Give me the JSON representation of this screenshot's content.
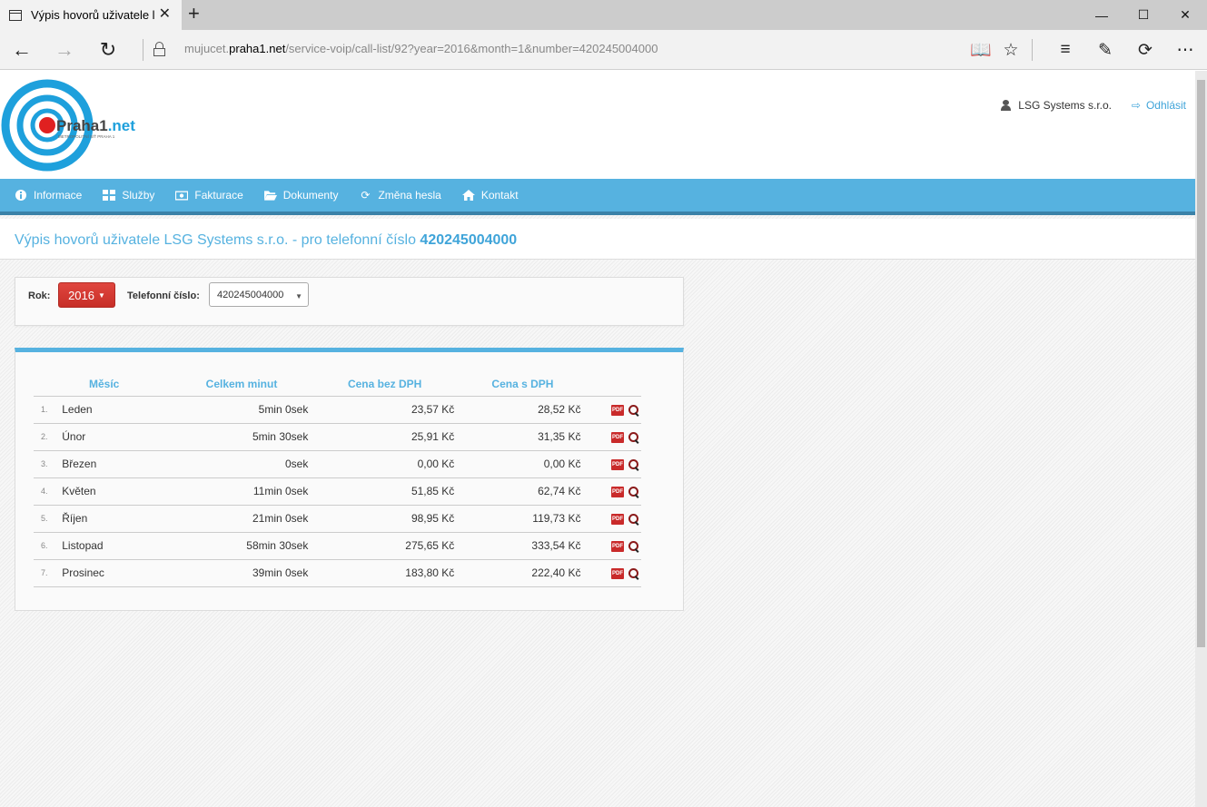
{
  "browser": {
    "tab_title": "Výpis hovorů uživatele l",
    "url_prefix": "mujucet.",
    "url_domain": "praha1.net",
    "url_path": "/service-voip/call-list/92?year=2016&month=1&number=420245004000"
  },
  "header": {
    "logo_text": "Praha1",
    "logo_suffix": ".net",
    "logo_subtitle": "METROPOLITNÍ SÍŤ PRAHA 1",
    "user_name": "LSG Systems s.r.o.",
    "logout_label": "Odhlásit"
  },
  "nav": {
    "items": [
      {
        "label": "Informace",
        "icon": "info-icon"
      },
      {
        "label": "Služby",
        "icon": "grid-icon"
      },
      {
        "label": "Fakturace",
        "icon": "money-icon"
      },
      {
        "label": "Dokumenty",
        "icon": "folder-icon"
      },
      {
        "label": "Změna hesla",
        "icon": "refresh-icon"
      },
      {
        "label": "Kontakt",
        "icon": "home-icon"
      }
    ]
  },
  "page": {
    "title_prefix": "Výpis hovorů uživatele LSG Systems s.r.o. - pro telefonní číslo ",
    "title_number": "420245004000"
  },
  "filter": {
    "year_label": "Rok:",
    "year_value": "2016",
    "number_label": "Telefonní číslo:",
    "number_value": "420245004000"
  },
  "table": {
    "headers": [
      "Měsíc",
      "Celkem minut",
      "Cena bez DPH",
      "Cena s DPH"
    ],
    "pdf_label": "PDF",
    "rows": [
      {
        "idx": "1.",
        "month": "Leden",
        "minutes": "5min 0sek",
        "price": "23,57 Kč",
        "price_vat": "28,52 Kč"
      },
      {
        "idx": "2.",
        "month": "Únor",
        "minutes": "5min 30sek",
        "price": "25,91 Kč",
        "price_vat": "31,35 Kč"
      },
      {
        "idx": "3.",
        "month": "Březen",
        "minutes": "0sek",
        "price": "0,00 Kč",
        "price_vat": "0,00 Kč"
      },
      {
        "idx": "4.",
        "month": "Květen",
        "minutes": "11min 0sek",
        "price": "51,85 Kč",
        "price_vat": "62,74 Kč"
      },
      {
        "idx": "5.",
        "month": "Říjen",
        "minutes": "21min 0sek",
        "price": "98,95 Kč",
        "price_vat": "119,73 Kč"
      },
      {
        "idx": "6.",
        "month": "Listopad",
        "minutes": "58min 30sek",
        "price": "275,65 Kč",
        "price_vat": "333,54 Kč"
      },
      {
        "idx": "7.",
        "month": "Prosinec",
        "minutes": "39min 0sek",
        "price": "183,80 Kč",
        "price_vat": "222,40 Kč"
      }
    ]
  },
  "colors": {
    "brand_blue": "#56b2e0",
    "year_red": "#d9362f",
    "logo_red": "#e02020"
  }
}
